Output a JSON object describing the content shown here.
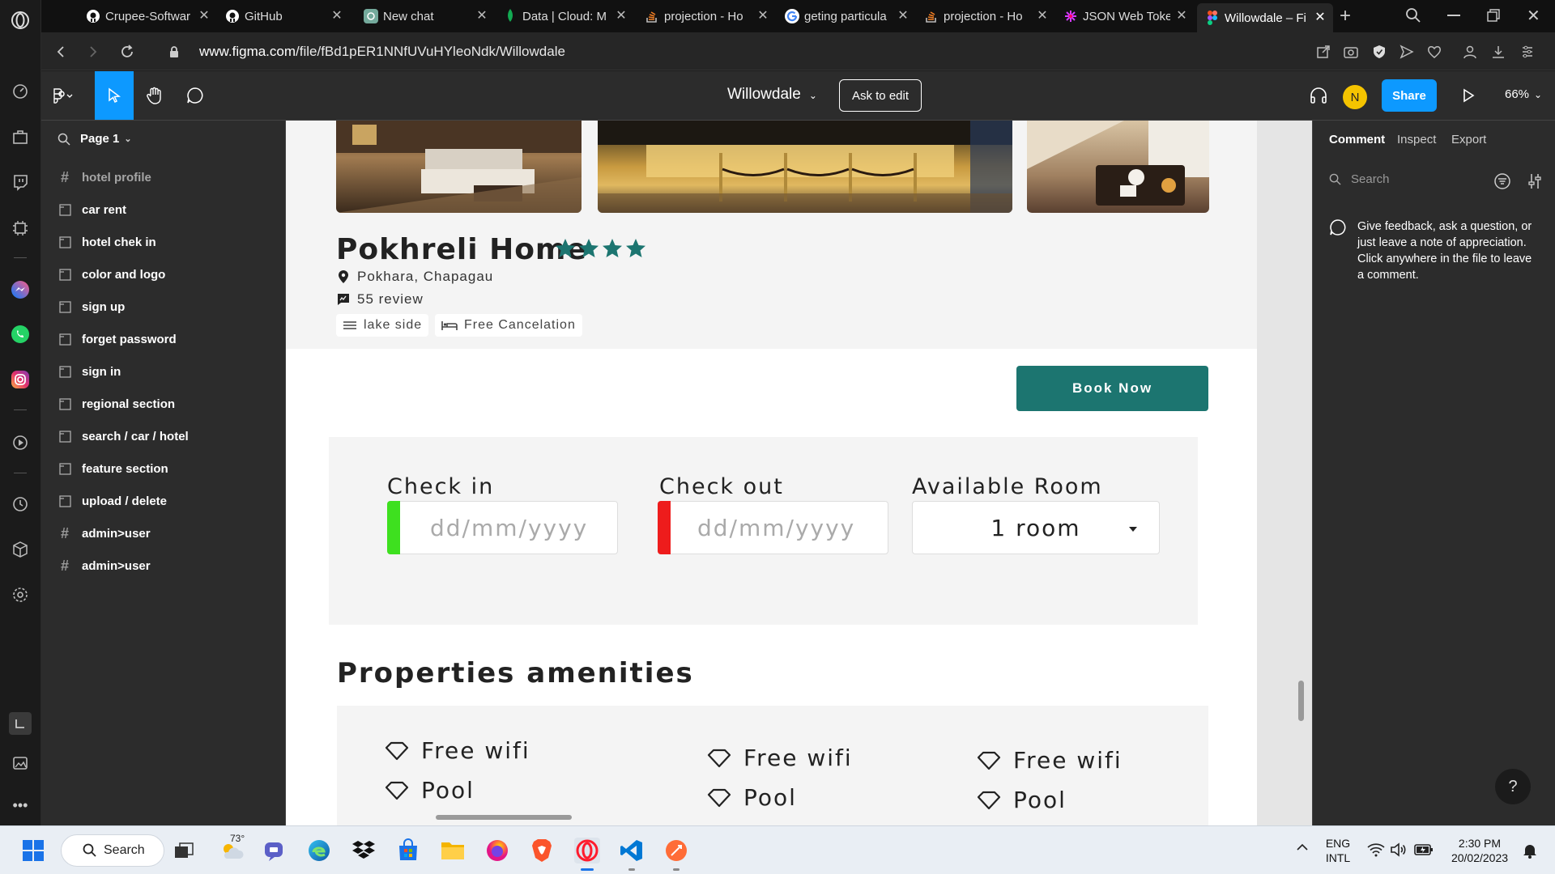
{
  "browser": {
    "tabs": [
      {
        "title": "Crupee-Softwar",
        "icon": "github-icon"
      },
      {
        "title": "GitHub",
        "icon": "github-icon"
      },
      {
        "title": "New chat",
        "icon": "chatgpt-icon"
      },
      {
        "title": "Data | Cloud: M",
        "icon": "mongodb-icon"
      },
      {
        "title": "projection - Ho",
        "icon": "stackoverflow-icon"
      },
      {
        "title": "geting particula",
        "icon": "google-icon"
      },
      {
        "title": "projection - Ho",
        "icon": "stackoverflow-icon"
      },
      {
        "title": "JSON Web Toke",
        "icon": "jwt-icon"
      },
      {
        "title": "Willowdale – Fi",
        "icon": "figma-icon",
        "active": true
      }
    ],
    "url_domain": "www.figma.com",
    "url_path": "/file/fBd1pER1NNfUVuHYleoNdk/Willowdale"
  },
  "figma": {
    "file_title": "Willowdale",
    "ask_to_edit": "Ask to edit",
    "avatar_initial": "N",
    "share": "Share",
    "zoom": "66%",
    "page": "Page 1",
    "layers": [
      {
        "name": "hotel profile",
        "icon": "frame",
        "dim": true
      },
      {
        "name": "car rent",
        "icon": "section"
      },
      {
        "name": "hotel chek in",
        "icon": "section"
      },
      {
        "name": "color and logo",
        "icon": "section"
      },
      {
        "name": "sign up",
        "icon": "section"
      },
      {
        "name": "forget password",
        "icon": "section"
      },
      {
        "name": "sign in",
        "icon": "section"
      },
      {
        "name": "regional section",
        "icon": "section"
      },
      {
        "name": "search / car / hotel",
        "icon": "section"
      },
      {
        "name": "feature section",
        "icon": "section"
      },
      {
        "name": "upload / delete",
        "icon": "section"
      },
      {
        "name": "admin>user",
        "icon": "frame"
      },
      {
        "name": "admin>user",
        "icon": "frame"
      }
    ],
    "right_panel": {
      "tabs": [
        "Comment",
        "Inspect",
        "Export"
      ],
      "search_placeholder": "Search",
      "message": "Give feedback, ask a question, or just leave a note of appreciation. Click anywhere in the file to leave a comment.",
      "help": "?"
    }
  },
  "design": {
    "hotel_name": "Pokhreli Home",
    "stars": 4,
    "location": "Pokhara, Chapagau",
    "reviews": "55 review",
    "chips": [
      "lake side",
      "Free Cancelation"
    ],
    "book_now": "Book Now",
    "check_in_label": "Check in",
    "check_out_label": "Check out",
    "available_room_label": "Available Room",
    "date_placeholder": "dd/mm/yyyy",
    "room_value": "1 room",
    "amenities_title": "Properties amenities",
    "amenities": [
      [
        "Free wifi",
        "Pool"
      ],
      [
        "Free wifi",
        "Pool"
      ],
      [
        "Free wifi",
        "Pool"
      ]
    ],
    "colors": {
      "accent": "#1c7570",
      "checkin_bar": "#3ee01f",
      "checkout_bar": "#ee1c1c"
    }
  },
  "taskbar": {
    "search": "Search",
    "weather_temp": "73°",
    "lang_line1": "ENG",
    "lang_line2": "INTL",
    "time": "2:30 PM",
    "date": "20/02/2023"
  }
}
